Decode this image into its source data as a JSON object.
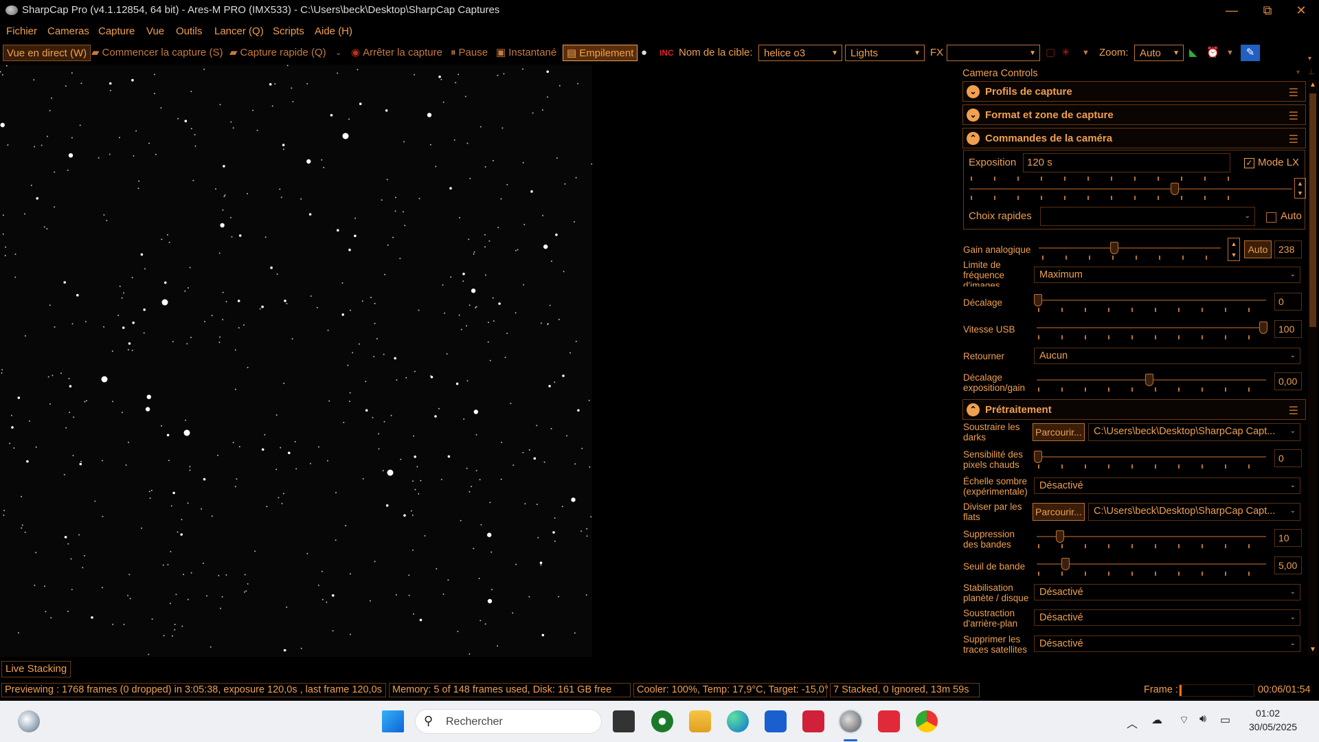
{
  "window": {
    "title": "SharpCap Pro (v4.1.12854, 64 bit) - Ares-M PRO (IMX533) - C:\\Users\\beck\\Desktop\\SharpCap Captures",
    "minimize": "—",
    "restore": "⧉",
    "close": "✕"
  },
  "menu": [
    "Fichier",
    "Cameras",
    "Capture",
    "Vue",
    "Outils",
    "Lancer (Q)",
    "Scripts",
    "Aide (H)"
  ],
  "toolbar": {
    "live_view": "Vue en direct (W)",
    "start_capture": "Commencer la capture (S)",
    "quick_capture": "Capture rapide (Q)",
    "stop_capture": "Arrêter la capture",
    "pause": "Pause",
    "snapshot": "Instantané",
    "stacking": "Empilement",
    "target_label": "Nom de la cible:",
    "target_value": "helice o3",
    "frame_type": "Lights",
    "fx_label": "FX",
    "fx_value": "",
    "zoom_label": "Zoom:",
    "zoom_value": "Auto"
  },
  "panel": {
    "title": "Camera Controls",
    "sections": {
      "profiles": "Profils de capture",
      "format": "Format et zone de capture",
      "camera": "Commandes de la caméra",
      "preprocessing": "Prétraitement"
    },
    "camera": {
      "exposure_label": "Exposition",
      "exposure_value": "120 s",
      "lx_label": "Mode LX",
      "lx_checked": "✓",
      "quick_choice_label": "Choix rapides",
      "quick_auto_label": "Auto",
      "gain_label": "Gain analogique",
      "gain_auto": "Auto",
      "gain_value": "238",
      "fps_label": "Limite de fréquence d'images",
      "fps_value": "Maximum",
      "offset_label": "Décalage",
      "offset_value": "0",
      "usb_label": "Vitesse USB",
      "usb_value": "100",
      "flip_label": "Retourner",
      "flip_value": "Aucun",
      "expgain_label": "Décalage exposition/gain",
      "expgain_value": "0,00"
    },
    "pre": {
      "darks_label": "Soustraire les darks",
      "browse": "Parcourir...",
      "darks_path": "C:\\Users\\beck\\Desktop\\SharpCap Capt...",
      "hotpix_label": "Sensibilité des pixels chauds",
      "hotpix_value": "0",
      "darkscale_label": "Échelle sombre (expérimentale)",
      "darkscale_value": "Désactivé",
      "flats_label": "Diviser par les flats",
      "flats_path": "C:\\Users\\beck\\Desktop\\SharpCap Capt...",
      "banding_label": "Suppression des bandes",
      "banding_value": "10",
      "bandthr_label": "Seuil de bande",
      "bandthr_value": "5,00",
      "stab_label": "Stabilisation planète / disque",
      "stab_value": "Désactivé",
      "bgsub_label": "Soustraction d'arrière-plan",
      "bgsub_value": "Désactivé",
      "sat_label": "Supprimer les traces satellites",
      "sat_value": "Désactivé"
    }
  },
  "live_stacking_tab": "Live Stacking",
  "status": {
    "preview": "Previewing : 1768 frames (0 dropped) in 3:05:38, exposure 120,0s , last frame 120,0s",
    "memory": "Memory: 5 of 148 frames used, Disk: 161 GB free",
    "cooler": "Cooler: 100%, Temp: 17,9°C, Target: -15,0°",
    "stacked": "7 Stacked, 0 Ignored, 13m 59s",
    "frame_label": "Frame :",
    "frame_progress": 0.03,
    "elapsed": "00:06/01:54"
  },
  "taskbar": {
    "search_placeholder": "Rechercher",
    "time": "01:02",
    "date": "30/05/2025"
  },
  "colors": {
    "accent": "#f0a050",
    "border": "#6a3a16",
    "background": "#000000"
  }
}
